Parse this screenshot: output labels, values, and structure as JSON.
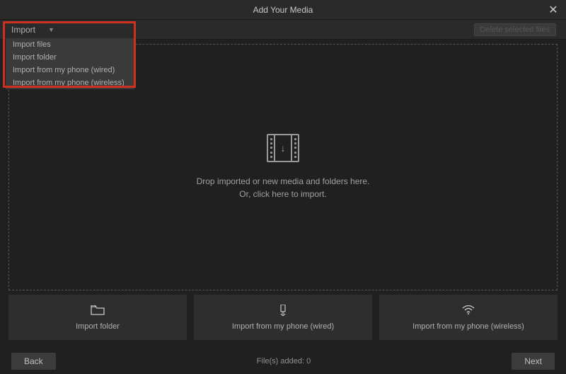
{
  "header": {
    "title": "Add Your Media"
  },
  "toolbar": {
    "import_label": "Import",
    "delete_label": "Delete selected files"
  },
  "dropdown": {
    "items": [
      "Import files",
      "Import folder",
      "Import from my phone (wired)",
      "Import from my phone (wireless)"
    ]
  },
  "dropzone": {
    "line1": "Drop imported or new media and folders here.",
    "line2": "Or, click here to import."
  },
  "actions": [
    {
      "label": "Import folder",
      "icon": "folder"
    },
    {
      "label": "Import from my phone (wired)",
      "icon": "phone-wired"
    },
    {
      "label": "Import from my phone (wireless)",
      "icon": "wifi"
    }
  ],
  "footer": {
    "back": "Back",
    "status": "File(s) added: 0",
    "next": "Next"
  }
}
